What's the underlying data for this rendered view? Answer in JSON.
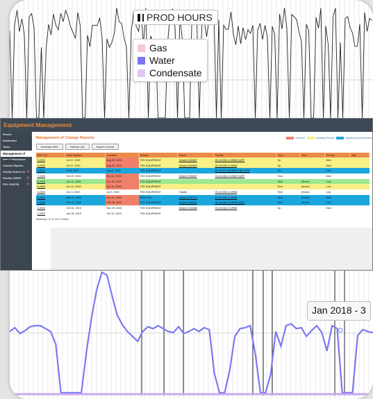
{
  "chart": {
    "title": "PROD HOURS",
    "legend": [
      {
        "label": "Gas",
        "color": "#f3c9cd"
      },
      {
        "label": "Water",
        "color": "#7b78f2"
      },
      {
        "label": "Condensate",
        "color": "#e0c8f2"
      }
    ],
    "tooltip": "Jan 2018 - 3",
    "line_color": "#7b78f2",
    "water_series": [
      63,
      67,
      61,
      64,
      68,
      69,
      69,
      66,
      63,
      50,
      0,
      0,
      0,
      0,
      0,
      42,
      78,
      106,
      124,
      121,
      100,
      80,
      70,
      63,
      58,
      53,
      63,
      68,
      66,
      69,
      66,
      63,
      62,
      68,
      61,
      63,
      66,
      63,
      67,
      65,
      20,
      0,
      0,
      23,
      58,
      66,
      67,
      69,
      40,
      0,
      0,
      19,
      63,
      48,
      69,
      71,
      66,
      67,
      58,
      64,
      69,
      62,
      43,
      69,
      66,
      0,
      0,
      0,
      59,
      65,
      63,
      62
    ]
  },
  "app": {
    "header_title": "Equipment Management",
    "sidebar": {
      "nav": [
        "Search",
        "Dashboard",
        "Tasks",
        "Management of Change",
        "Non-Conformance",
        "Custom Reports"
      ],
      "active_index": 3,
      "filters": [
        "Facility Search #1",
        "Facility #39667",
        "PSV #100756"
      ]
    },
    "page_title": "Management of Change Reports",
    "status_legend": [
      {
        "label": "Overdue",
        "color": "#f1806a"
      },
      {
        "label": "Awaiting Review",
        "color": "#f6f086"
      },
      {
        "label": "Awaiting Documentation",
        "color": "#1ba6dd"
      }
    ],
    "buttons": [
      "Generate MOC",
      "Refresh List",
      "Export to Excel"
    ],
    "columns": [
      "MOC No",
      "Date Initiated",
      "Deadline",
      "Initiator",
      "Assoc.",
      "Facility",
      "Type",
      "Desc",
      "Priority",
      "Stat"
    ],
    "rows": [
      {
        "bg": "#f6f086",
        "dl": "#f1806a",
        "cells": [
          "3-2022",
          "Jul 27, 2022",
          "Aug 25, 2022",
          "TED EQUIPMENT",
          "Vessel #136667",
          "09-19-038-13 W5M SURF",
          "Op",
          "",
          "Med",
          ""
        ]
      },
      {
        "bg": "#f6f086",
        "dl": "#f1806a",
        "cells": [
          "2-2022",
          "Jul 27, 2022",
          "Aug 31, 2022",
          "TED EQUIPMENT",
          "Vessel #140843",
          "09-19-038-13 W5M",
          "Op",
          "",
          "Med",
          ""
        ]
      },
      {
        "bg": "#1ba6dd",
        "dl": "",
        "cells": [
          "1-2022",
          "Jul 6, 2022",
          "Aug 8, 2022",
          "TED EQUIPMENT",
          "",
          "10-19-077-08 W6M PRO SITE",
          "Op",
          "",
          "Low",
          ""
        ]
      },
      {
        "bg": "#ffffff",
        "dl": "#f1806a",
        "cells": [
          "7-2020",
          "Oct 20, 2020",
          "Oct 31, 2020",
          "TED EQUIPMENT",
          "Vessel #136667",
          "09-19-038-13 W5M SURF",
          "Tech",
          "",
          "Med",
          ""
        ]
      },
      {
        "bg": "#9ee88e",
        "dl": "#f1806a",
        "cells": [
          "6-2020",
          "Jun 11, 2020",
          "Jun 18, 2020",
          "TED EQUIPMENT",
          "",
          "",
          "Tech",
          "(Hover)",
          "Low",
          ""
        ]
      },
      {
        "bg": "#f6f086",
        "dl": "#f1806a",
        "cells": [
          "5-2020",
          "Jun 11, 2020",
          "Jun 13, 2020",
          "TED EQUIPMENT",
          "",
          "",
          "Tech",
          "(Hover)",
          "Low",
          ""
        ]
      },
      {
        "bg": "#ffffff",
        "dl": "",
        "cells": [
          "4-2020",
          "Jun 3, 2020",
          "Jul 3, 2020",
          "TED EQUIPMENT",
          "Facility",
          "09-19-038-13 W5M",
          "Tech",
          "(Hover)",
          "Low",
          ""
        ]
      },
      {
        "bg": "#1ba6dd",
        "dl": "#f1806a",
        "cells": [
          "3-2020",
          "Mar 17, 2020",
          "Jun 16, 2020",
          "BENOITB",
          "Vessel #139174",
          "12-29-038-13 W5M",
          "Tech",
          "(Hover)",
          "Med",
          ""
        ]
      },
      {
        "bg": "#1ba6dd",
        "dl": "#f1806a",
        "cells": [
          "1-2020",
          "Feb 11, 2020",
          "Feb 28, 2020",
          "TED EQUIPMENT",
          "Vessel #136667",
          "09-19-038-13 W5M SURF",
          "Tech",
          "(Hover)",
          "Low",
          ""
        ]
      },
      {
        "bg": "#ffffff",
        "dl": "",
        "cells": [
          "2-2019",
          "Oct 30, 2019",
          "Nov 29, 2019",
          "TED EQUIPMENT",
          "Vessel #133085",
          "09-19-038-13 W5M",
          "Op",
          "",
          "Med",
          ""
        ]
      },
      {
        "bg": "#ffffff",
        "dl": "",
        "cells": [
          "1-2019",
          "Jan 25, 2019",
          "Oct 31, 2019",
          "TED EQUIPMENT",
          "",
          "",
          "",
          "",
          "",
          ""
        ]
      }
    ],
    "entries_text": "Showing 1 to 11 of 11 entries"
  }
}
